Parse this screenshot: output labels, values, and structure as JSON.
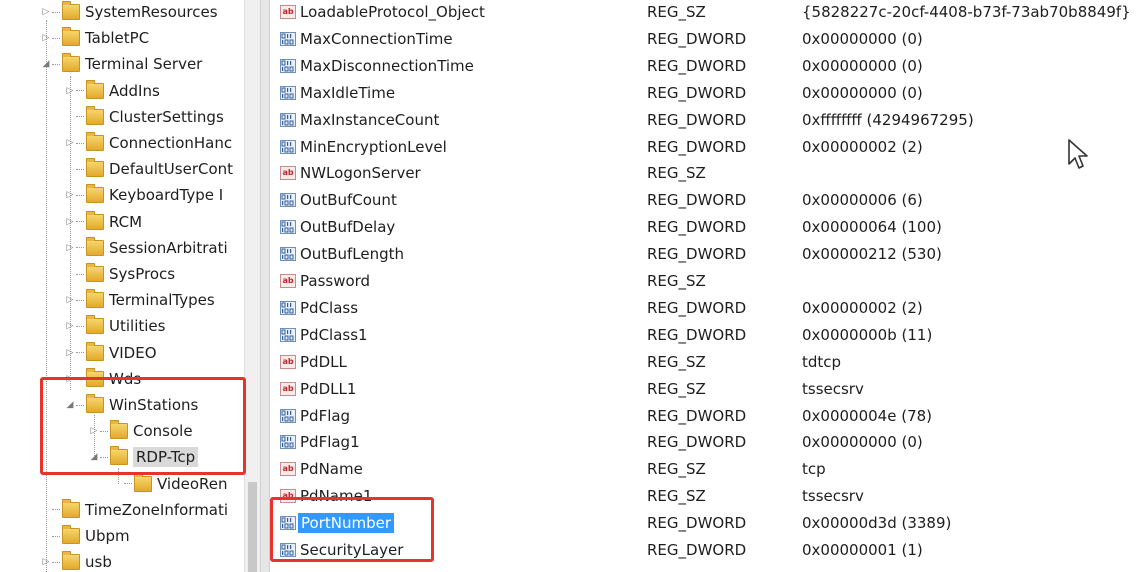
{
  "tree": {
    "items": [
      {
        "label": "SystemResources",
        "indent": 0,
        "expander": "closed"
      },
      {
        "label": "TabletPC",
        "indent": 0,
        "expander": "closed"
      },
      {
        "label": "Terminal Server",
        "indent": 0,
        "expander": "open"
      },
      {
        "label": "AddIns",
        "indent": 1,
        "expander": "closed"
      },
      {
        "label": "ClusterSettings",
        "indent": 1,
        "expander": "none"
      },
      {
        "label": "ConnectionHanc",
        "indent": 1,
        "expander": "closed"
      },
      {
        "label": "DefaultUserCont",
        "indent": 1,
        "expander": "none"
      },
      {
        "label": "KeyboardType I",
        "indent": 1,
        "expander": "closed"
      },
      {
        "label": "RCM",
        "indent": 1,
        "expander": "closed"
      },
      {
        "label": "SessionArbitrati",
        "indent": 1,
        "expander": "closed"
      },
      {
        "label": "SysProcs",
        "indent": 1,
        "expander": "none"
      },
      {
        "label": "TerminalTypes",
        "indent": 1,
        "expander": "closed"
      },
      {
        "label": "Utilities",
        "indent": 1,
        "expander": "closed"
      },
      {
        "label": "VIDEO",
        "indent": 1,
        "expander": "closed"
      },
      {
        "label": "Wds",
        "indent": 1,
        "expander": "closed"
      },
      {
        "label": "WinStations",
        "indent": 1,
        "expander": "open"
      },
      {
        "label": "Console",
        "indent": 2,
        "expander": "closed"
      },
      {
        "label": "RDP-Tcp",
        "indent": 2,
        "expander": "open",
        "selected": true
      },
      {
        "label": "VideoRen",
        "indent": 3,
        "expander": "none"
      },
      {
        "label": "TimeZoneInformati",
        "indent": 0,
        "expander": "none"
      },
      {
        "label": "Ubpm",
        "indent": 0,
        "expander": "none"
      },
      {
        "label": "usb",
        "indent": 0,
        "expander": "closed"
      }
    ]
  },
  "values": [
    {
      "name": "LoadableProtocol_Object",
      "type": "REG_SZ",
      "data": "{5828227c-20cf-4408-b73f-73ab70b8849f}",
      "icon": "string-value-icon"
    },
    {
      "name": "MaxConnectionTime",
      "type": "REG_DWORD",
      "data": "0x00000000 (0)",
      "icon": "binary-value-icon"
    },
    {
      "name": "MaxDisconnectionTime",
      "type": "REG_DWORD",
      "data": "0x00000000 (0)",
      "icon": "binary-value-icon"
    },
    {
      "name": "MaxIdleTime",
      "type": "REG_DWORD",
      "data": "0x00000000 (0)",
      "icon": "binary-value-icon"
    },
    {
      "name": "MaxInstanceCount",
      "type": "REG_DWORD",
      "data": "0xffffffff (4294967295)",
      "icon": "binary-value-icon"
    },
    {
      "name": "MinEncryptionLevel",
      "type": "REG_DWORD",
      "data": "0x00000002 (2)",
      "icon": "binary-value-icon"
    },
    {
      "name": "NWLogonServer",
      "type": "REG_SZ",
      "data": "",
      "icon": "string-value-icon"
    },
    {
      "name": "OutBufCount",
      "type": "REG_DWORD",
      "data": "0x00000006 (6)",
      "icon": "binary-value-icon"
    },
    {
      "name": "OutBufDelay",
      "type": "REG_DWORD",
      "data": "0x00000064 (100)",
      "icon": "binary-value-icon"
    },
    {
      "name": "OutBufLength",
      "type": "REG_DWORD",
      "data": "0x00000212 (530)",
      "icon": "binary-value-icon"
    },
    {
      "name": "Password",
      "type": "REG_SZ",
      "data": "",
      "icon": "string-value-icon"
    },
    {
      "name": "PdClass",
      "type": "REG_DWORD",
      "data": "0x00000002 (2)",
      "icon": "binary-value-icon"
    },
    {
      "name": "PdClass1",
      "type": "REG_DWORD",
      "data": "0x0000000b (11)",
      "icon": "binary-value-icon"
    },
    {
      "name": "PdDLL",
      "type": "REG_SZ",
      "data": "tdtcp",
      "icon": "string-value-icon"
    },
    {
      "name": "PdDLL1",
      "type": "REG_SZ",
      "data": "tssecsrv",
      "icon": "string-value-icon"
    },
    {
      "name": "PdFlag",
      "type": "REG_DWORD",
      "data": "0x0000004e (78)",
      "icon": "binary-value-icon"
    },
    {
      "name": "PdFlag1",
      "type": "REG_DWORD",
      "data": "0x00000000 (0)",
      "icon": "binary-value-icon"
    },
    {
      "name": "PdName",
      "type": "REG_SZ",
      "data": "tcp",
      "icon": "string-value-icon"
    },
    {
      "name": "PdName1",
      "type": "REG_SZ",
      "data": "tssecsrv",
      "icon": "string-value-icon"
    },
    {
      "name": "PortNumber",
      "type": "REG_DWORD",
      "data": "0x00000d3d (3389)",
      "icon": "binary-value-icon",
      "selected": true
    },
    {
      "name": "SecurityLayer",
      "type": "REG_DWORD",
      "data": "0x00000001 (1)",
      "icon": "binary-value-icon"
    }
  ],
  "icons": {
    "binary_glyph": "011 110",
    "string_glyph": "ab"
  },
  "colors": {
    "highlight_box": "#e8322b",
    "selection": "#3399ff",
    "folder": "#e2a92d"
  }
}
